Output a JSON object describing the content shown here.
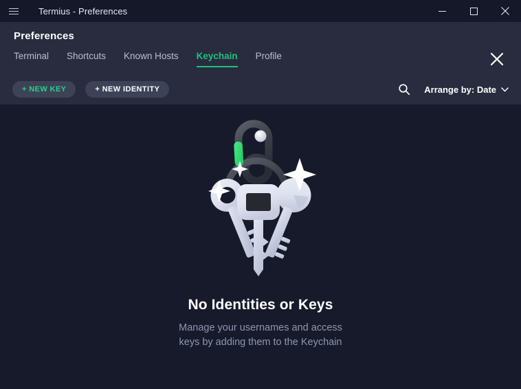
{
  "titlebar": {
    "menu_icon": "hamburger-icon",
    "title": "Termius - Preferences",
    "controls": [
      {
        "name": "minimize",
        "icon": "minimize-icon"
      },
      {
        "name": "maximize",
        "icon": "maximize-icon"
      },
      {
        "name": "close",
        "icon": "close-icon"
      }
    ]
  },
  "header": {
    "title": "Preferences",
    "close_icon": "close-icon",
    "tabs": [
      {
        "label": "Terminal",
        "active": false
      },
      {
        "label": "Shortcuts",
        "active": false
      },
      {
        "label": "Known Hosts",
        "active": false
      },
      {
        "label": "Keychain",
        "active": true
      },
      {
        "label": "Profile",
        "active": false
      }
    ]
  },
  "toolbar": {
    "new_key_label": "+ NEW KEY",
    "new_identity_label": "+ NEW IDENTITY",
    "search_icon": "search-icon",
    "arrange_label": "Arrange by: Date",
    "arrange_chevron_icon": "chevron-down-icon"
  },
  "empty_state": {
    "illustration": "keychain-keys-illustration",
    "title": "No Identities or Keys",
    "description": "Manage your usernames and access keys by adding them to the Keychain"
  },
  "colors": {
    "accent_green": "#1fc17b",
    "button_green": "#29d08b",
    "titlebar_bg": "#151828",
    "header_bg": "#282c3e",
    "content_bg": "#161a2b",
    "pill_bg": "#3d4257",
    "muted_text": "#8f96ad"
  }
}
